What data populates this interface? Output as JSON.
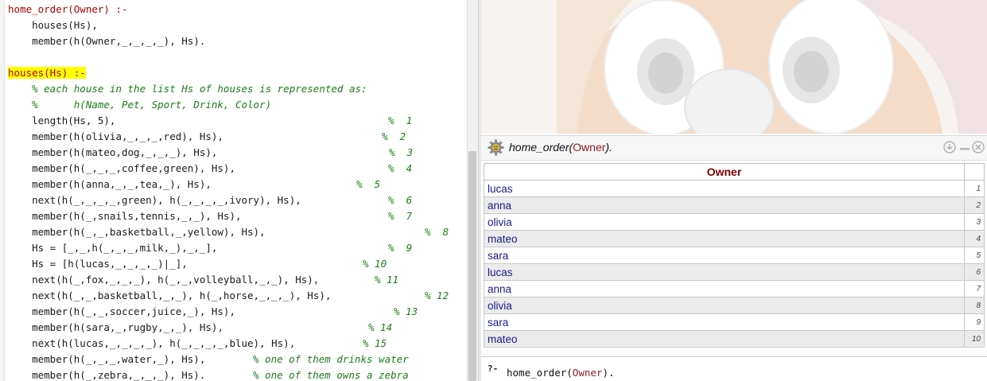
{
  "editor": {
    "lines": [
      {
        "code": "home_order(Owner) :-",
        "comment": "",
        "style": "header"
      },
      {
        "code": "    houses(Hs),",
        "comment": "",
        "style": ""
      },
      {
        "code": "    member(h(Owner,_,_,_,_), Hs).",
        "comment": "",
        "style": ""
      },
      {
        "code": "",
        "comment": "",
        "style": ""
      },
      {
        "code": "houses(Hs) :-",
        "comment": "",
        "style": "highlight"
      },
      {
        "code": "    % each house in the list Hs of houses is represented as:",
        "comment": "",
        "style": "comment"
      },
      {
        "code": "    %      h(Name, Pet, Sport, Drink, Color)",
        "comment": "",
        "style": "comment"
      },
      {
        "code": "    length(Hs, 5),",
        "comment": "%  1",
        "style": ""
      },
      {
        "code": "    member(h(olivia,_,_,_,red), Hs),",
        "comment": "%  2",
        "style": ""
      },
      {
        "code": "    member(h(mateo,dog,_,_,_), Hs),",
        "comment": "%  3",
        "style": ""
      },
      {
        "code": "    member(h(_,_,_,coffee,green), Hs),",
        "comment": "%  4",
        "style": ""
      },
      {
        "code": "    member(h(anna,_,_,tea,_), Hs),",
        "comment": "%  5",
        "style": ""
      },
      {
        "code": "    next(h(_,_,_,_,green), h(_,_,_,_,ivory), Hs),",
        "comment": "%  6",
        "style": ""
      },
      {
        "code": "    member(h(_,snails,tennis,_,_), Hs),",
        "comment": "%  7",
        "style": ""
      },
      {
        "code": "    member(h(_,_,basketball,_,yellow), Hs),",
        "comment": "%  8",
        "style": ""
      },
      {
        "code": "    Hs = [_,_,h(_,_,_,milk,_),_,_],",
        "comment": "%  9",
        "style": ""
      },
      {
        "code": "    Hs = [h(lucas,_,_,_,_)|_],",
        "comment": "% 10",
        "style": ""
      },
      {
        "code": "    next(h(_,fox,_,_,_), h(_,_,volleyball,_,_), Hs),",
        "comment": "% 11",
        "style": ""
      },
      {
        "code": "    next(h(_,_,basketball,_,_), h(_,horse,_,_,_), Hs),",
        "comment": "% 12",
        "style": ""
      },
      {
        "code": "    member(h(_,_,soccer,juice,_), Hs),",
        "comment": "% 13",
        "style": ""
      },
      {
        "code": "    member(h(sara,_,rugby,_,_), Hs),",
        "comment": "% 14",
        "style": ""
      },
      {
        "code": "    next(h(lucas,_,_,_,_), h(_,_,_,_,blue), Hs),",
        "comment": "% 15",
        "style": ""
      },
      {
        "code": "    member(h(_,_,_,water,_), Hs),",
        "comment": "% one of them drinks water",
        "style": ""
      },
      {
        "code": "    member(h(_,zebra,_,_,_), Hs).",
        "comment": "% one of them owns a zebra",
        "style": ""
      }
    ]
  },
  "query": {
    "title_fn": "home_order(",
    "title_arg": "Owner",
    "title_end": ").",
    "column_header": "Owner",
    "rows": [
      {
        "value": "lucas",
        "index": "1"
      },
      {
        "value": "anna",
        "index": "2"
      },
      {
        "value": "olivia",
        "index": "3"
      },
      {
        "value": "mateo",
        "index": "4"
      },
      {
        "value": "sara",
        "index": "5"
      },
      {
        "value": "lucas",
        "index": "6"
      },
      {
        "value": "anna",
        "index": "7"
      },
      {
        "value": "olivia",
        "index": "8"
      },
      {
        "value": "sara",
        "index": "9"
      },
      {
        "value": "mateo",
        "index": "10"
      }
    ]
  },
  "input": {
    "prompt": "?-",
    "text_fn": "home_order(",
    "text_arg": "Owner",
    "text_end": ")."
  },
  "colors": {
    "highlight": "#ffff00",
    "header_text": "#b00000",
    "comment": "#1b7c1b",
    "table_text": "#1a1a8a",
    "column_header": "#7a0000"
  },
  "icons": [
    "gear-icon",
    "download-icon",
    "minimize-icon",
    "close-icon"
  ]
}
